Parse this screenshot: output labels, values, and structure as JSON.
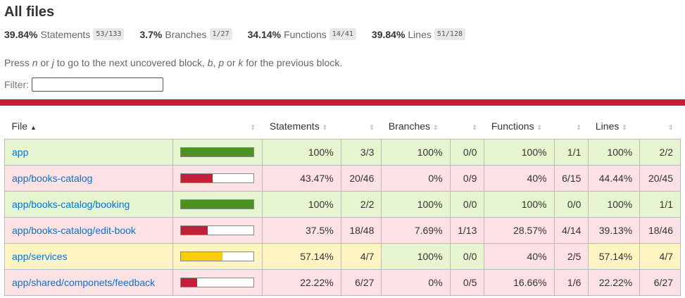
{
  "title": "All files",
  "summary": [
    {
      "pct": "39.84%",
      "label": "Statements",
      "frac": "53/133"
    },
    {
      "pct": "3.7%",
      "label": "Branches",
      "frac": "1/27"
    },
    {
      "pct": "34.14%",
      "label": "Functions",
      "frac": "14/41"
    },
    {
      "pct": "39.84%",
      "label": "Lines",
      "frac": "51/128"
    }
  ],
  "hint": {
    "t1": "Press ",
    "n": "n",
    "t2": " or ",
    "j": "j",
    "t3": " to go to the next uncovered block, ",
    "b": "b",
    "t4": ", ",
    "p": "p",
    "t5": " or ",
    "k": "k",
    "t6": " for the previous block."
  },
  "filter": {
    "label": "Filter:",
    "value": ""
  },
  "columns": {
    "file": "File",
    "sort_up": "▲",
    "sort": "⇕",
    "statements": "Statements",
    "branches": "Branches",
    "functions": "Functions",
    "lines": "Lines"
  },
  "colors": {
    "high": "#4d9221",
    "low": "#c21f39",
    "medium": "#f9cd0b",
    "link": "#0074d9"
  },
  "rows": [
    {
      "file": "app",
      "level": "high",
      "bar": 1.0,
      "stmt_pct": "100%",
      "stmt": "3/3",
      "br_pct": "100%",
      "br": "0/0",
      "br_level": "high",
      "fn_pct": "100%",
      "fn": "1/1",
      "fn_level": "high",
      "ln_pct": "100%",
      "ln": "2/2",
      "ln_level": "high"
    },
    {
      "file": "app/books-catalog",
      "level": "low",
      "bar": 0.4347,
      "stmt_pct": "43.47%",
      "stmt": "20/46",
      "br_pct": "0%",
      "br": "0/9",
      "br_level": "low",
      "fn_pct": "40%",
      "fn": "6/15",
      "fn_level": "low",
      "ln_pct": "44.44%",
      "ln": "20/45",
      "ln_level": "low"
    },
    {
      "file": "app/books-catalog/booking",
      "level": "high",
      "bar": 1.0,
      "stmt_pct": "100%",
      "stmt": "2/2",
      "br_pct": "100%",
      "br": "0/0",
      "br_level": "high",
      "fn_pct": "100%",
      "fn": "0/0",
      "fn_level": "high",
      "ln_pct": "100%",
      "ln": "1/1",
      "ln_level": "high"
    },
    {
      "file": "app/books-catalog/edit-book",
      "level": "low",
      "bar": 0.375,
      "stmt_pct": "37.5%",
      "stmt": "18/48",
      "br_pct": "7.69%",
      "br": "1/13",
      "br_level": "low",
      "fn_pct": "28.57%",
      "fn": "4/14",
      "fn_level": "low",
      "ln_pct": "39.13%",
      "ln": "18/46",
      "ln_level": "low"
    },
    {
      "file": "app/services",
      "level": "medium",
      "bar": 0.5714,
      "stmt_pct": "57.14%",
      "stmt": "4/7",
      "br_pct": "100%",
      "br": "0/0",
      "br_level": "high",
      "fn_pct": "40%",
      "fn": "2/5",
      "fn_level": "low",
      "ln_pct": "57.14%",
      "ln": "4/7",
      "ln_level": "medium"
    },
    {
      "file": "app/shared/componets/feedback",
      "level": "low",
      "bar": 0.2222,
      "stmt_pct": "22.22%",
      "stmt": "6/27",
      "br_pct": "0%",
      "br": "0/5",
      "br_level": "low",
      "fn_pct": "16.66%",
      "fn": "1/6",
      "fn_level": "low",
      "ln_pct": "22.22%",
      "ln": "6/27",
      "ln_level": "low"
    }
  ]
}
